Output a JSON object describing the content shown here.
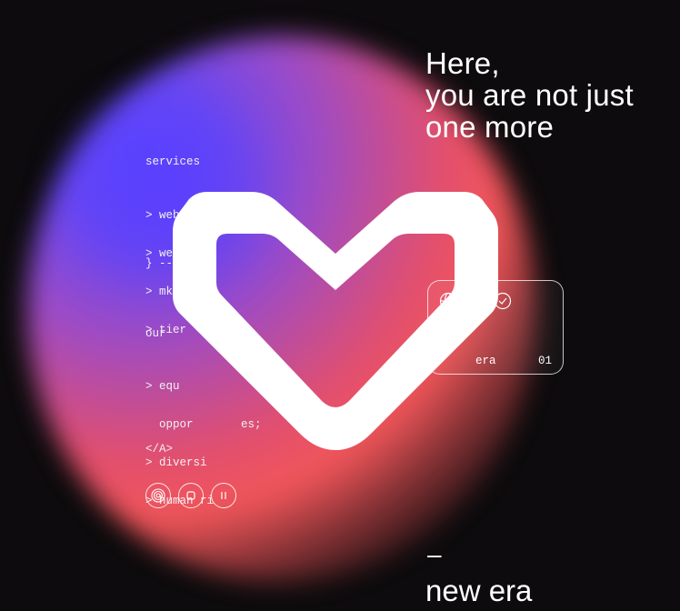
{
  "headline": {
    "line1": "Here,",
    "line2": "you are not just",
    "line3": "one more"
  },
  "services": {
    "title": "services",
    "items": [
      "> web 2;",
      "> web 3;",
      "> mkt &",
      "> tier"
    ],
    "closing": "} ------"
  },
  "values": {
    "title": "our",
    "items": [
      "> equ",
      "  oppor       es;",
      "> diversi",
      "> human ri"
    ]
  },
  "closing_tag": "</A>",
  "controls": {
    "icons": [
      "target-icon",
      "stop-icon",
      "pause-icon"
    ]
  },
  "card": {
    "icons": [
      "globe-icon",
      "check-circle-icon"
    ],
    "label": "era",
    "number": "01"
  },
  "heart": {
    "icon": "heart-logo-icon",
    "color": "#ffffff"
  },
  "footer": {
    "dash": "–",
    "tagline": "new era"
  },
  "colors": {
    "background": "#0d0b0d",
    "gradient_blue": "#5a46ff",
    "gradient_red": "#f2565a",
    "text": "#ffffff"
  }
}
